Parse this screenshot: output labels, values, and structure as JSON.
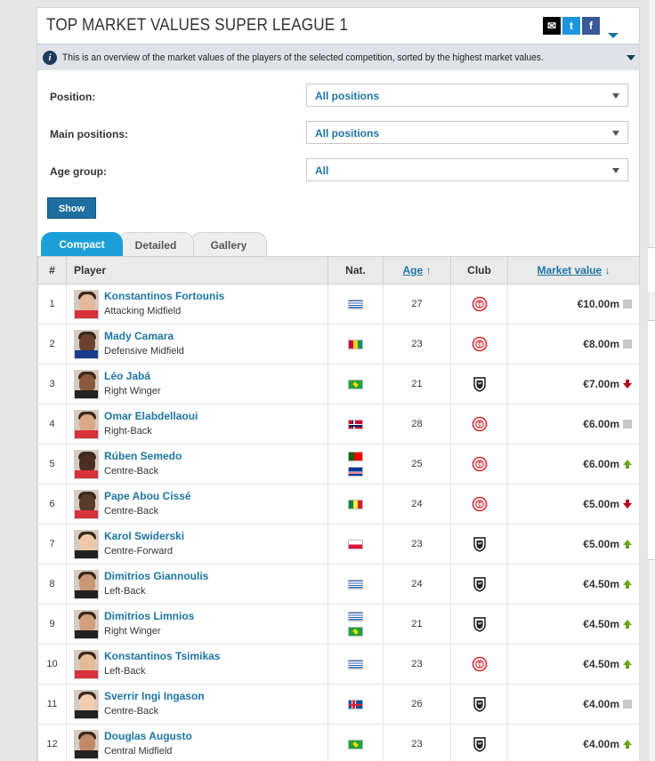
{
  "header": {
    "title": "TOP MARKET VALUES SUPER LEAGUE 1"
  },
  "share": {
    "mail": "✉",
    "twitter": "t",
    "facebook": "f"
  },
  "info": {
    "text": "This is an overview of the market values of the players of the selected competition, sorted by the highest market values."
  },
  "filters": [
    {
      "label": "Position:",
      "value": "All positions"
    },
    {
      "label": "Main positions:",
      "value": "All positions"
    },
    {
      "label": "Age group:",
      "value": "All"
    }
  ],
  "show_button": "Show",
  "tabs": [
    "Compact",
    "Detailed",
    "Gallery"
  ],
  "table": {
    "headers": {
      "num": "#",
      "player": "Player",
      "nat": "Nat.",
      "age": "Age",
      "age_sort": "↑",
      "club": "Club",
      "mv": "Market value",
      "mv_sort": "↓"
    },
    "rows": [
      {
        "num": "1",
        "name": "Konstantinos Fortounis",
        "pos": "Attacking Midfield",
        "flags": [
          "gr"
        ],
        "age": "27",
        "club": "olympiacos",
        "value": "€10.00m",
        "trend": "none"
      },
      {
        "num": "2",
        "name": "Mady Camara",
        "pos": "Defensive Midfield",
        "flags": [
          "gn"
        ],
        "age": "23",
        "club": "olympiacos",
        "value": "€8.00m",
        "trend": "none"
      },
      {
        "num": "3",
        "name": "Léo Jabá",
        "pos": "Right Winger",
        "flags": [
          "br"
        ],
        "age": "21",
        "club": "paok",
        "value": "€7.00m",
        "trend": "down"
      },
      {
        "num": "4",
        "name": "Omar Elabdellaoui",
        "pos": "Right-Back",
        "flags": [
          "no"
        ],
        "age": "28",
        "club": "olympiacos",
        "value": "€6.00m",
        "trend": "none"
      },
      {
        "num": "5",
        "name": "Rúben Semedo",
        "pos": "Centre-Back",
        "flags": [
          "pt",
          "cv"
        ],
        "age": "25",
        "club": "olympiacos",
        "value": "€6.00m",
        "trend": "up"
      },
      {
        "num": "6",
        "name": "Pape Abou Cissé",
        "pos": "Centre-Back",
        "flags": [
          "sn"
        ],
        "age": "24",
        "club": "olympiacos",
        "value": "€5.00m",
        "trend": "down"
      },
      {
        "num": "7",
        "name": "Karol Swiderski",
        "pos": "Centre-Forward",
        "flags": [
          "pl"
        ],
        "age": "23",
        "club": "paok",
        "value": "€5.00m",
        "trend": "up"
      },
      {
        "num": "8",
        "name": "Dimitrios Giannoulis",
        "pos": "Left-Back",
        "flags": [
          "gr"
        ],
        "age": "24",
        "club": "paok",
        "value": "€4.50m",
        "trend": "up"
      },
      {
        "num": "9",
        "name": "Dimitrios Limnios",
        "pos": "Right Winger",
        "flags": [
          "gr",
          "br"
        ],
        "age": "21",
        "club": "paok",
        "value": "€4.50m",
        "trend": "up"
      },
      {
        "num": "10",
        "name": "Konstantinos Tsimikas",
        "pos": "Left-Back",
        "flags": [
          "gr"
        ],
        "age": "23",
        "club": "olympiacos",
        "value": "€4.50m",
        "trend": "up"
      },
      {
        "num": "11",
        "name": "Sverrir Ingi Ingason",
        "pos": "Centre-Back",
        "flags": [
          "is"
        ],
        "age": "26",
        "club": "paok",
        "value": "€4.00m",
        "trend": "none"
      },
      {
        "num": "12",
        "name": "Douglas Augusto",
        "pos": "Central Midfield",
        "flags": [
          "br"
        ],
        "age": "23",
        "club": "paok",
        "value": "€4.00m",
        "trend": "up"
      }
    ]
  }
}
